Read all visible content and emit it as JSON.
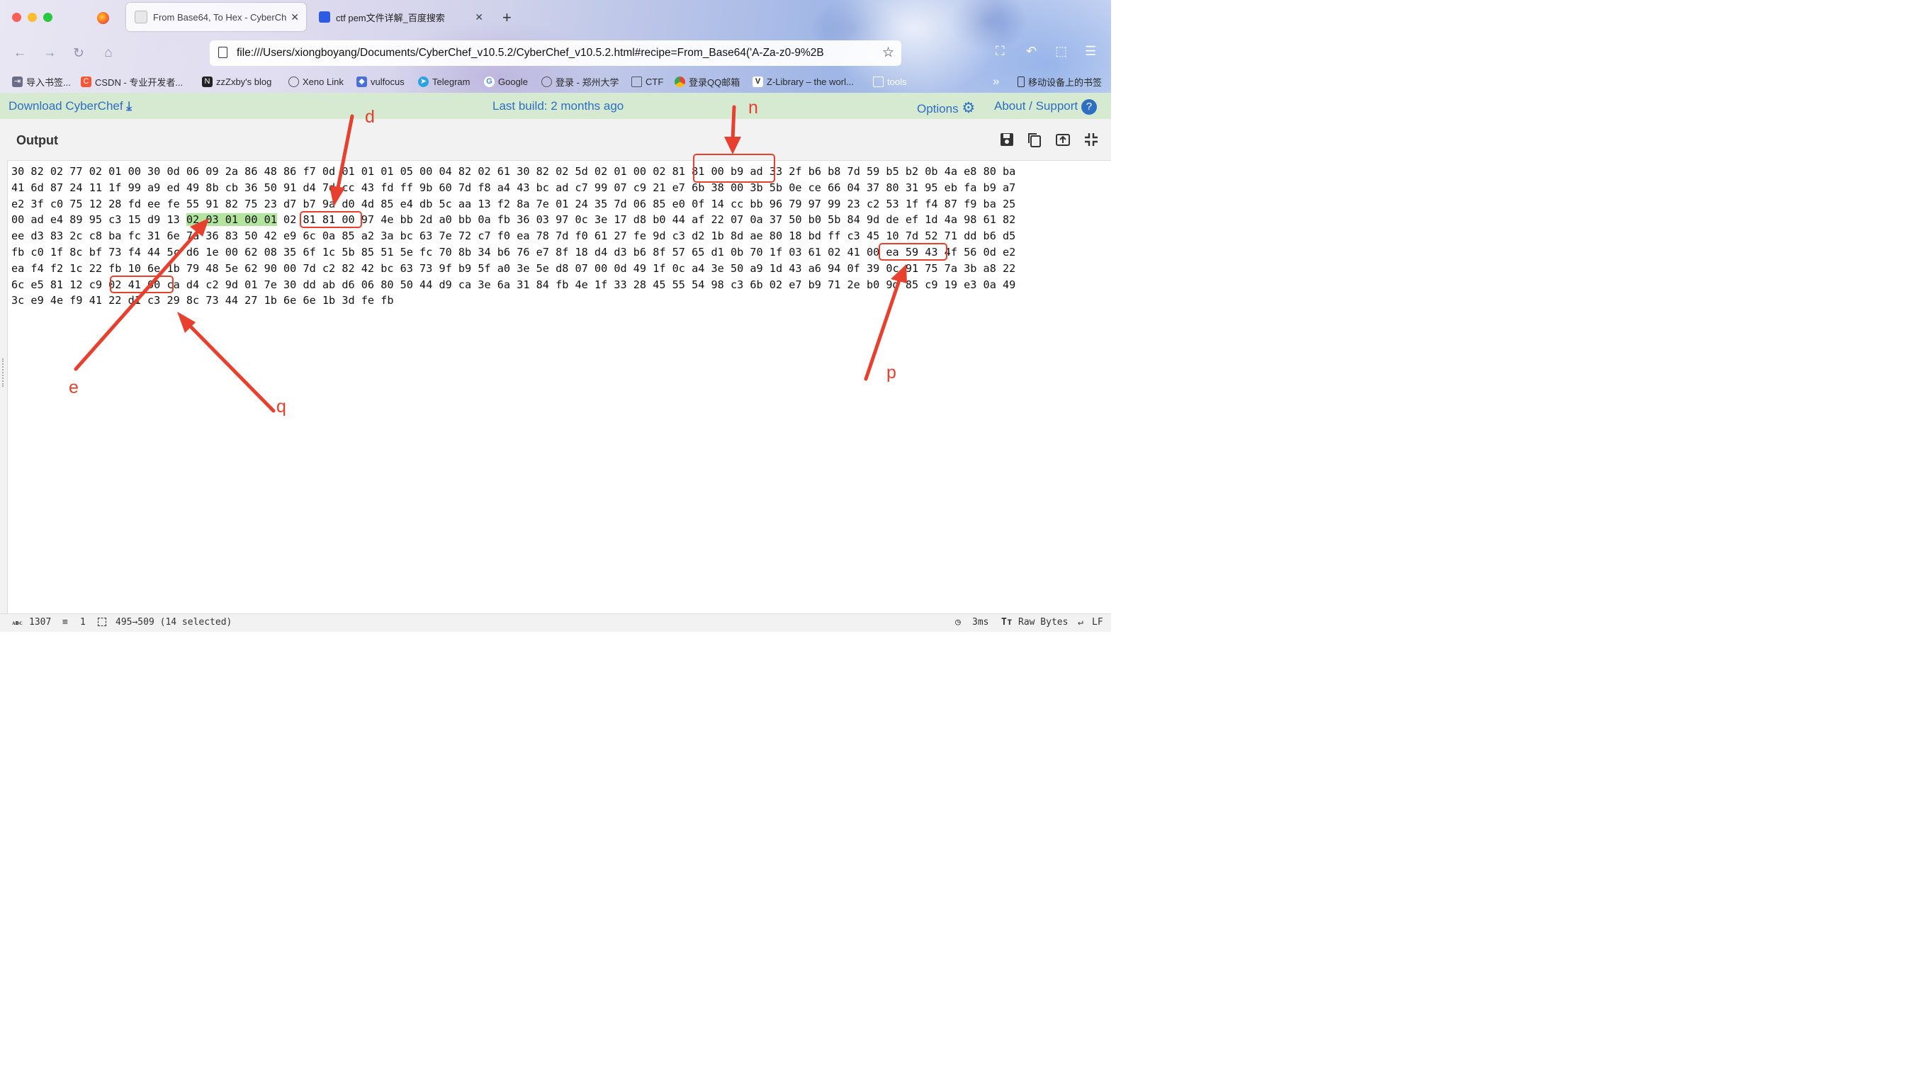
{
  "browser": {
    "tabs": [
      {
        "title": "From Base64, To Hex - CyberCh",
        "active": true
      },
      {
        "title": "ctf pem文件详解_百度搜索",
        "active": false
      }
    ],
    "url": "file:///Users/xiongboyang/Documents/CyberChef_v10.5.2/CyberChef_v10.5.2.html#recipe=From_Base64('A-Za-z0-9%2B",
    "bookmarks": [
      {
        "label": "导入书签...",
        "icon": "import-icon"
      },
      {
        "label": "CSDN - 专业开发者...",
        "icon": "csdn-icon"
      },
      {
        "label": "zzZxby's blog",
        "icon": "blog-icon"
      },
      {
        "label": "Xeno Link",
        "icon": "globe-icon"
      },
      {
        "label": "vulfocus",
        "icon": "shield-icon"
      },
      {
        "label": "Telegram",
        "icon": "telegram-icon"
      },
      {
        "label": "Google",
        "icon": "google-icon"
      },
      {
        "label": "登录 - 郑州大学",
        "icon": "globe-icon"
      },
      {
        "label": "CTF",
        "icon": "folder-icon"
      },
      {
        "label": "登录QQ邮箱",
        "icon": "chrome-icon"
      },
      {
        "label": "Z-Library – the worl...",
        "icon": "zlib-icon"
      },
      {
        "label": "tools",
        "icon": "folder-icon"
      }
    ],
    "mobile_bookmarks": "移动设备上的书签"
  },
  "cyberchef": {
    "download_label": "Download CyberChef",
    "last_build": "Last build: 2 months ago",
    "options_label": "Options",
    "about_label": "About / Support",
    "output_title": "Output"
  },
  "output": {
    "lines": [
      [
        {
          "t": "30 82 02 77 02 01 00 30 0d 06 09 2a 86 48 86 f7 0d 01 01 01 05 00 04 82 02 61 30 82 02 5d 02 01 00 "
        },
        {
          "t": "02 81 81 00"
        },
        {
          "t": " b9 ad 33 2f b6 b8 7d 59 b5 b2 0b 4a e8 80 ba"
        }
      ],
      [
        {
          "t": "41 6d 87 24 11 1f 99 a9 ed 49 8b cb 36 50 91 d4 7d cc 43 fd ff 9b 60 7d f8 a4 43 bc ad c7 99 07 c9 21 e7 6b 38 00 3b 5b 0e ce 66 04 37 80 31 95 eb fa b9 a7"
        }
      ],
      [
        {
          "t": "e2 3f c0 75 12 28 fd ee fe 55 91 82 75 23 d7 b7 9a d0 4d 85 e4 db 5c aa 13 f2 8a 7e 01 24 35 7d 06 85 e0 0f 14 cc bb 96 79 97 99 23 c2 53 1f f4 87 f9 ba 25"
        }
      ],
      [
        {
          "t": "00 ad e4 89 95 c3 15 d9 13 "
        },
        {
          "t": "02 03 01 00 01",
          "hl": true
        },
        {
          "t": " 02 81 81 00 97 4e bb 2d a0 bb 0a fb 36 03 97 0c 3e 17 d8 b0 44 af 22 07 0a 37 50 b0 5b 84 9d de ef 1d 4a 98 61 82"
        }
      ],
      [
        {
          "t": "ee d3 83 2c c8 ba fc 31 6e 7a 36 83 50 42 e9 6c 0a 85 a2 3a bc 63 7e 72 c7 f0 ea 78 7d f0 61 27 fe 9d c3 d2 1b 8d ae 80 18 bd ff c3 45 10 7d 52 71 dd b6 d5"
        }
      ],
      [
        {
          "t": "fb c0 1f 8c bf 73 f4 44 5c d6 1e 00 62 08 35 6f 1c 5b 85 51 5e fc 70 8b 34 b6 76 e7 8f 18 d4 d3 b6 8f 57 65 d1 0b 70 1f 03 61 02 41 00 ea 59 43 4f 56 0d e2"
        }
      ],
      [
        {
          "t": "ea f4 f2 1c 22 fb 10 6e 1b 79 48 5e 62 90 00 7d c2 82 42 bc 63 73 9f b9 5f a0 3e 5e d8 07 00 0d 49 1f 0c a4 3e 50 a9 1d 43 a6 94 0f 39 0c 91 75 7a 3b a8 22"
        }
      ],
      [
        {
          "t": "6c e5 81 12 c9 02 41 00 ca d4 c2 9d 01 7e 30 dd ab d6 06 80 50 44 d9 ca 3e 6a 31 84 fb 4e 1f 33 28 45 55 54 98 c3 6b 02 e7 b9 71 2e b0 9d 85 c9 19 e3 0a 49"
        }
      ],
      [
        {
          "t": "3c e9 4e f9 41 22 d1 c3 29 8c 73 44 27 1b 6e 6e 1b 3d fe fb"
        }
      ]
    ]
  },
  "annotations": {
    "d": "d",
    "n": "n",
    "e": "e",
    "q": "q",
    "p": "p",
    "color": "#e8402e"
  },
  "status": {
    "abc_label": "ᴀʙᴄ",
    "length": "1307",
    "lines": "1",
    "selection": "495→509 (14 selected)",
    "time": "3ms",
    "encoding": "Raw Bytes",
    "eol": "LF"
  }
}
